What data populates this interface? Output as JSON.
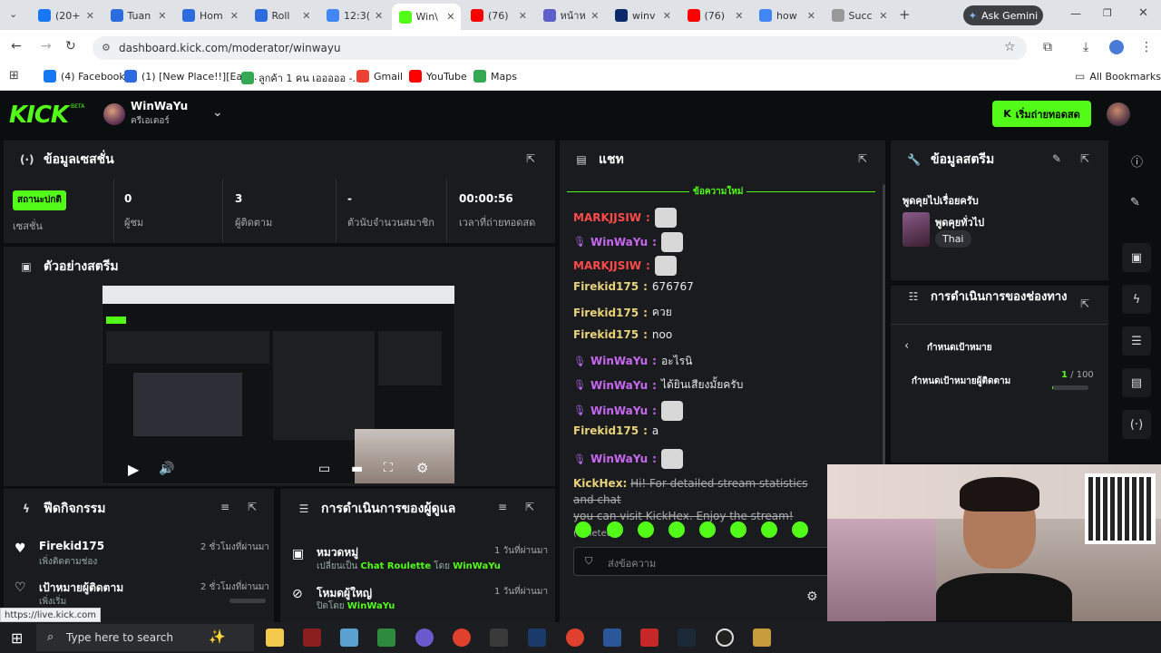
{
  "browser": {
    "tabs": [
      {
        "label": "(20+",
        "color": "#1877f2"
      },
      {
        "label": "Tuan",
        "color": "#2d6cdf"
      },
      {
        "label": "Hom",
        "color": "#2d6cdf"
      },
      {
        "label": "Roll",
        "color": "#2d6cdf"
      },
      {
        "label": "12:3(",
        "color": "#4285f4"
      },
      {
        "label": "Win\\",
        "color": "#53fc18"
      },
      {
        "label": "(76)",
        "color": "#ff0000"
      },
      {
        "label": "หน้าห",
        "color": "#5b5fc7"
      },
      {
        "label": "winv",
        "color": "#0a2a6a"
      },
      {
        "label": "(76)",
        "color": "#ff0000"
      },
      {
        "label": "how",
        "color": "#4285f4"
      },
      {
        "label": "Succ",
        "color": "#999999"
      }
    ],
    "gemini_label": "Ask Gemini",
    "url": "dashboard.kick.com/moderator/winwayu",
    "bookmarks": [
      {
        "label": "(4) Facebook",
        "color": "#1877f2"
      },
      {
        "label": "(1) [New Place!!][Eaz...",
        "color": "#2d6cdf"
      },
      {
        "label": "ลูกค้า 1 คน เอออออ -...",
        "color": "#34a853"
      },
      {
        "label": "Gmail",
        "color": "#ea4335"
      },
      {
        "label": "YouTube",
        "color": "#ff0000"
      },
      {
        "label": "Maps",
        "color": "#34a853"
      }
    ],
    "all_bookmarks": "All Bookmarks",
    "status_url": "https://live.kick.com"
  },
  "header": {
    "logo": "KICK",
    "logo_badge": "BETA",
    "channel_name": "WinWaYu",
    "channel_role": "ครีเอเตอร์",
    "go_live_label": "เริ่มถ่ายทอดสด",
    "accent": "#53fc18"
  },
  "session": {
    "title": "ข้อมูลเซสชั่น",
    "status_badge": "สถานะปกติ",
    "status_label": "เซสชั่น",
    "stats": [
      {
        "value": "0",
        "label": "ผู้ชม"
      },
      {
        "value": "3",
        "label": "ผู้ติดตาม"
      },
      {
        "value": "-",
        "label": "ตัวนับจำนวนสมาชิก"
      },
      {
        "value": "00:00:56",
        "label": "เวลาที่ถ่ายทอดสด"
      }
    ]
  },
  "preview": {
    "title": "ตัวอย่างสตรีม"
  },
  "chat": {
    "title": "แชท",
    "new_messages": "ข้อความใหม่",
    "input_placeholder": "ส่งข้อความ",
    "messages": [
      {
        "user": "MARKJJSIW",
        "color": "#ff4a4a",
        "text": "",
        "emote": true,
        "mic": false
      },
      {
        "user": "WinWaYu",
        "color": "#c868f0",
        "text": "",
        "emote": true,
        "mic": true
      },
      {
        "user": "MARKJJSIW",
        "color": "#ff4a4a",
        "text": "",
        "emote": true,
        "mic": false
      },
      {
        "user": "Firekid175",
        "color": "#e8d27a",
        "text": "676767",
        "emote": false,
        "mic": false
      },
      {
        "user": "Firekid175",
        "color": "#e8d27a",
        "text": "ควย",
        "emote": false,
        "mic": false
      },
      {
        "user": "Firekid175",
        "color": "#e8d27a",
        "text": "noo",
        "emote": false,
        "mic": false
      },
      {
        "user": "WinWaYu",
        "color": "#c868f0",
        "text": "อะไรนิ",
        "emote": false,
        "mic": true
      },
      {
        "user": "WinWaYu",
        "color": "#c868f0",
        "text": "ได้ยินเสียงมั้ยครับ",
        "emote": false,
        "mic": true
      },
      {
        "user": "WinWaYu",
        "color": "#c868f0",
        "text": "",
        "emote": true,
        "mic": true
      },
      {
        "user": "Firekid175",
        "color": "#e8d27a",
        "text": "a",
        "emote": false,
        "mic": false
      },
      {
        "user": "WinWaYu",
        "color": "#c868f0",
        "text": "",
        "emote": true,
        "mic": true
      }
    ],
    "deleted": {
      "user": "KickHex",
      "line1": "Hi! For detailed stream statistics and chat",
      "line2": "you can visit KickHex. Enjoy the stream!",
      "tag": "(Deleted)"
    }
  },
  "stream_info": {
    "title": "ข้อมูลสตรีม",
    "stream_title": "พูดคุยไปเรื่อยครับ",
    "category": "พูดคุยทั่วไป",
    "language": "Thai"
  },
  "channel_actions": {
    "title": "การดำเนินการของช่องทาง",
    "goal_header": "กำหนดเป้าหมาย",
    "goal_label": "กำหนดเป้าหมายผู้ติดตาม",
    "goal_current": "1",
    "goal_target": "/ 100",
    "goal_fraction": 0.01
  },
  "activity": {
    "title": "ฟีดกิจกรรม",
    "items": [
      {
        "name": "Firekid175",
        "sub": "เพิ่งติดตามช่อง",
        "time": "2 ชั่วโมงที่ผ่านมา"
      },
      {
        "name": "เป้าหมายผู้ติดตาม",
        "sub": "เพิ่งเริ่ม",
        "time": "2 ชั่วโมงที่ผ่านมา"
      }
    ]
  },
  "mod_actions": {
    "title": "การดำเนินการของผู้ดูแล",
    "items": [
      {
        "name": "หมวดหมู่",
        "sub_prefix": "เปลี่ยนเป็น",
        "sub_target": "Chat Roulette",
        "sub_by": "โดย",
        "sub_user": "WinWaYu",
        "time": "1 วันที่ผ่านมา"
      },
      {
        "name": "โหมดผู้ใหญ่",
        "sub_prefix": "ปิดโดย",
        "sub_target": "",
        "sub_by": "",
        "sub_user": "WinWaYu",
        "time": "1 วันที่ผ่านมา"
      }
    ]
  },
  "taskbar": {
    "search_placeholder": "Type here to search"
  }
}
